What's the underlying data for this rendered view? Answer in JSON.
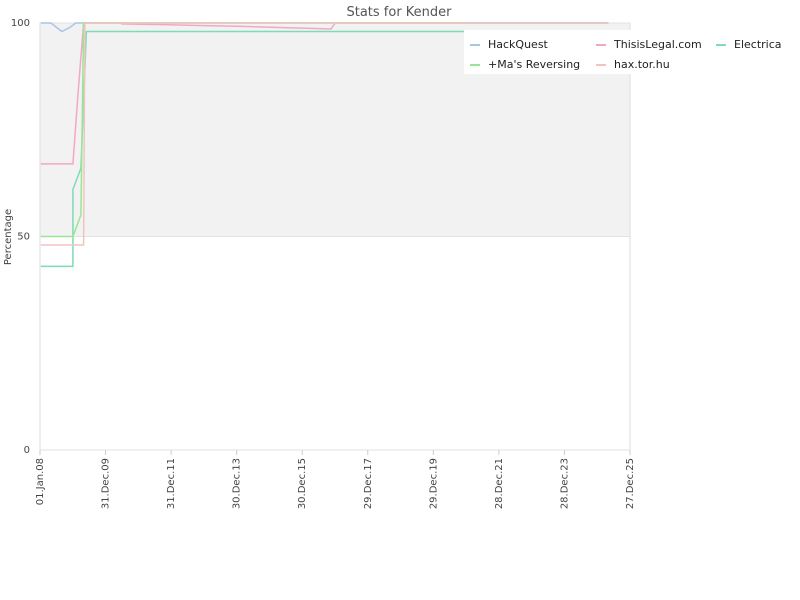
{
  "chart_data": {
    "type": "line",
    "title": "Stats for Kender",
    "xlabel": "",
    "ylabel": "Percentage",
    "ylim": [
      0,
      100
    ],
    "y_ticks": [
      0,
      50,
      100
    ],
    "x_ticks": [
      "01.Jan.08",
      "31.Dec.09",
      "31.Dec.11",
      "30.Dec.13",
      "30.Dec.15",
      "29.Dec.17",
      "29.Dec.19",
      "28.Dec.21",
      "28.Dec.23",
      "27.Dec.25"
    ],
    "xlim": [
      "2008-01-01",
      "2025-12-27"
    ],
    "legend_position": "top-right",
    "bands": [
      {
        "from": 50,
        "to": 100,
        "color": "#f2f2f2"
      }
    ],
    "series": [
      {
        "name": "HackQuest",
        "color": "#a9c4ea",
        "points": [
          [
            "2008-01-10",
            100
          ],
          [
            "2008-05-01",
            100
          ],
          [
            "2008-09-01",
            98
          ],
          [
            "2008-12-01",
            99
          ],
          [
            "2009-02-01",
            100
          ],
          [
            "2025-05-01",
            100
          ]
        ]
      },
      {
        "name": "ThisisLegal.com",
        "color": "#f2a7c6",
        "points": [
          [
            "2008-01-10",
            67
          ],
          [
            "2009-01-01",
            67
          ],
          [
            "2009-03-01",
            84
          ],
          [
            "2009-05-01",
            100
          ],
          [
            "2010-07-01",
            100
          ],
          [
            "2010-07-01",
            99.8
          ],
          [
            "2011-12-01",
            99.6
          ],
          [
            "2013-01-01",
            99.4
          ],
          [
            "2014-03-01",
            99.2
          ],
          [
            "2015-08-01",
            98.9
          ],
          [
            "2016-01-01",
            98.8
          ],
          [
            "2016-11-15",
            98.6
          ],
          [
            "2017-01-01",
            100
          ],
          [
            "2025-05-01",
            100
          ]
        ]
      },
      {
        "name": "Electrica",
        "color": "#7ddcb4",
        "points": [
          [
            "2008-01-10",
            43
          ],
          [
            "2009-01-01",
            43
          ],
          [
            "2009-01-01",
            61
          ],
          [
            "2009-04-01",
            66
          ],
          [
            "2009-06-01",
            98
          ],
          [
            "2025-05-01",
            98
          ]
        ]
      },
      {
        "name": "+Ma's Reversing",
        "color": "#9ae594",
        "points": [
          [
            "2008-01-10",
            50
          ],
          [
            "2009-01-01",
            50
          ],
          [
            "2009-04-01",
            55
          ],
          [
            "2009-05-01",
            100
          ],
          [
            "2025-05-01",
            100
          ]
        ]
      },
      {
        "name": "hax.tor.hu",
        "color": "#f2c4c0",
        "points": [
          [
            "2008-01-10",
            48
          ],
          [
            "2009-05-01",
            48
          ],
          [
            "2009-05-15",
            100
          ],
          [
            "2025-05-01",
            100
          ]
        ]
      }
    ]
  }
}
